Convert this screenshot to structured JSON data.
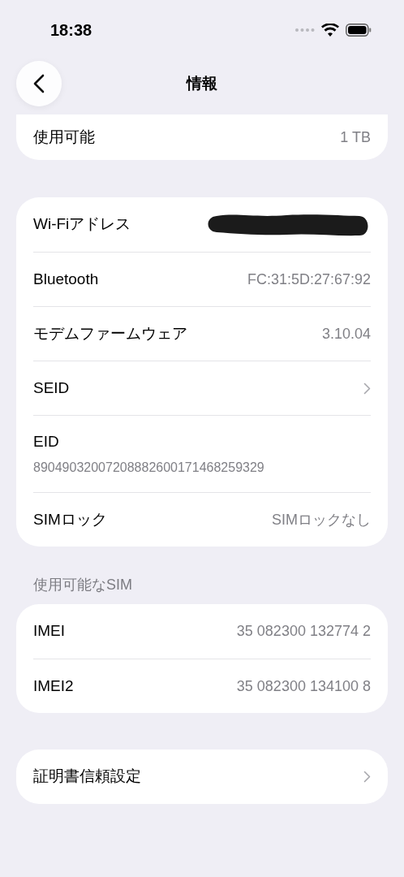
{
  "status_bar": {
    "time": "18:38"
  },
  "nav": {
    "title": "情報"
  },
  "groups": [
    {
      "clipped": true,
      "rows": [
        {
          "kind": "value",
          "label": "使用可能",
          "value": "1 TB"
        }
      ]
    },
    {
      "rows": [
        {
          "kind": "redacted",
          "label": "Wi-Fiアドレス"
        },
        {
          "kind": "value",
          "label": "Bluetooth",
          "value": "FC:31:5D:27:67:92"
        },
        {
          "kind": "value",
          "label": "モデムファームウェア",
          "value": "3.10.04"
        },
        {
          "kind": "chevron",
          "label": "SEID"
        },
        {
          "kind": "stacked",
          "label": "EID",
          "value": "89049032007208882600171468259329"
        },
        {
          "kind": "value",
          "label": "SIMロック",
          "value": "SIMロックなし"
        }
      ]
    },
    {
      "header": "使用可能なSIM",
      "rows": [
        {
          "kind": "value",
          "label": "IMEI",
          "value": "35 082300 132774 2"
        },
        {
          "kind": "value",
          "label": "IMEI2",
          "value": "35 082300 134100 8"
        }
      ]
    },
    {
      "rows": [
        {
          "kind": "chevron",
          "label": "証明書信頼設定"
        }
      ]
    }
  ]
}
